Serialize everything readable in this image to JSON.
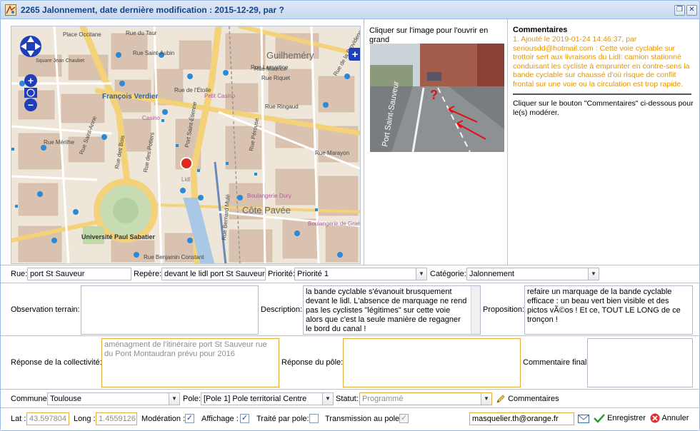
{
  "window": {
    "title": "2265 Jalonnement, date dernière modification : 2015-12-29, par ?",
    "restore_symbol": "❐",
    "close_symbol": "✕"
  },
  "map": {
    "zoom_in": "+",
    "zoom_out": "−",
    "layers": "+",
    "labels": [
      "Guilheméry",
      "Côte Pavée",
      "François Verdier",
      "Université Paul Sabatier",
      "Rue Riquet",
      "Rue Maurice",
      "Rue du Taur",
      "Rue Ringaud",
      "Rue Lamartine",
      "Rue de l'Étoile",
      "Rue des Potiers",
      "Rue Mérilhe",
      "Rue Saint-Anne",
      "Rue des Bois",
      "Rue Marayon",
      "Rue Bernard Mulé",
      "Rue Benjamin Constant",
      "Rue de la Providence",
      "Rue Pérouse",
      "Place Occitane",
      "Square Jean Chaubet",
      "Lidl",
      "Casino",
      "Petit Casino",
      "Boulangerie Dury",
      "Boulangerie de Grande",
      "Port Saint-Étienne",
      "Rue Saint-Aubin"
    ],
    "marker_color": "#e0261f"
  },
  "photo": {
    "caption": "Cliquer sur l'image pour l'ouvrir en grand",
    "street_sign": "Port Saint-Sauveur",
    "annotation": "?"
  },
  "comments": {
    "title": "Commentaires",
    "entry": "1. Ajouté le 2019-01-24 14:46:37, par seriousdd@hotmail.com : Cette voie cyclable sur trottoir sert aux livraisons du Lidl: camion stationné conduisant les cycliste à emprunter en contre-sens la bande cyclable sur chaussé d'où risque de conflit frontal sur une voie ou la circulation est trop rapide.",
    "hint": "Cliquer sur le bouton \"Commentaires\" ci-dessous pour le(s) modérer."
  },
  "form": {
    "rue_label": "Rue:",
    "rue_value": "port St Sauveur",
    "repere_label": "Repère:",
    "repere_value": "devant le lidl port St Sauveur",
    "priorite_label": "Priorité:",
    "priorite_value": "Priorité 1",
    "categorie_label": "Catégorie:",
    "categorie_value": "Jalonnement",
    "observation_label": "Observation terrain:",
    "observation_value": "",
    "description_label": "Description:",
    "description_value": "la bande cyclable s'évanouit brusquement devant le lidl. L'absence de marquage ne rend pas les cyclistes \"légitimes\" sur cette voie alors que c'est la seule manière de regagner le bord du canal !",
    "proposition_label": "Proposition:",
    "proposition_value": "refaire un marquage de la bande cyclable efficace : un beau vert bien visible et des pictos vÃ©os ! Et ce, TOUT LE LONG de ce tronçon !",
    "reponse_collectivite_label": "Réponse de la collectivité:",
    "reponse_collectivite_value": "aménagment de l'itinéraire port St Sauveur rue du Pont Montaudran prévu pour 2016",
    "reponse_pole_label": "Réponse du pôle:",
    "reponse_pole_value": "",
    "commentaire_final_label": "Commentaire final:",
    "commentaire_final_value": "",
    "commune_label": "Commune:",
    "commune_value": "Toulouse",
    "pole_label": "Pole:",
    "pole_value": "[Pole 1] Pole territorial Centre",
    "statut_label": "Statut:",
    "statut_value": "Programmé",
    "commentaires_button": "Commentaires",
    "lat_label": "Lat :",
    "lat_value": "43.597804",
    "long_label": "Long :",
    "long_value": "1.4559126",
    "moderation_label": "Modération :",
    "affichage_label": "Affichage :",
    "traite_label": "Traité par pole:",
    "transmission_label": "Transmission au pole",
    "email_value": "masquelier.th@orange.fr",
    "save_label": "Enregistrer",
    "cancel_label": "Annuler",
    "check": "✓"
  }
}
